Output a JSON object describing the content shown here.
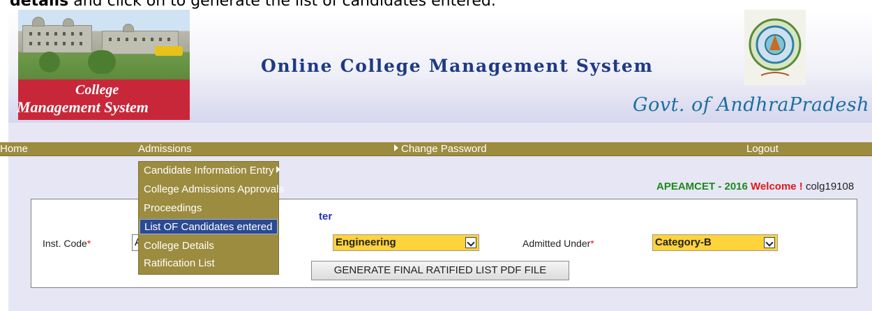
{
  "doc_text": {
    "bold": "details",
    "rest": " and click on to generate the list of candidates entered."
  },
  "banner": {
    "logo_line1": "College",
    "logo_line2": "Management System",
    "title": "Online College Management System",
    "gov_text": "Govt. of AndhraPradesh"
  },
  "menu": {
    "home": "Home",
    "admissions": "Admissions",
    "change_password": "Change Password",
    "logout": "Logout"
  },
  "admissions_menu": {
    "items": [
      "Candidate Information Entry",
      "College Admissions Approvals",
      "Proceedings",
      "List OF Candidates entered",
      "College Details",
      "Ratification List"
    ],
    "selected_index": 3
  },
  "status": {
    "exam": "APEAMCET - 2016",
    "welcome": "Welcome !",
    "user": "colg19108"
  },
  "form": {
    "heading_fragment": "ter",
    "inst_code_label": "Inst. Code",
    "inst_code_value": "A",
    "course_value": "Engineering",
    "admitted_under_label": "Admitted Under",
    "admitted_under_value": "Category-B",
    "required_mark": "*",
    "generate_button": "GENERATE FINAL RATIFIED LIST PDF FILE"
  },
  "colors": {
    "menu_bg": "#9c8c3f",
    "selected_bg": "#2c4a93",
    "select_bg": "#ffd33a",
    "exam_color": "#1b8a1b",
    "welcome_color": "#e01818",
    "title_color": "#1e3a86"
  }
}
